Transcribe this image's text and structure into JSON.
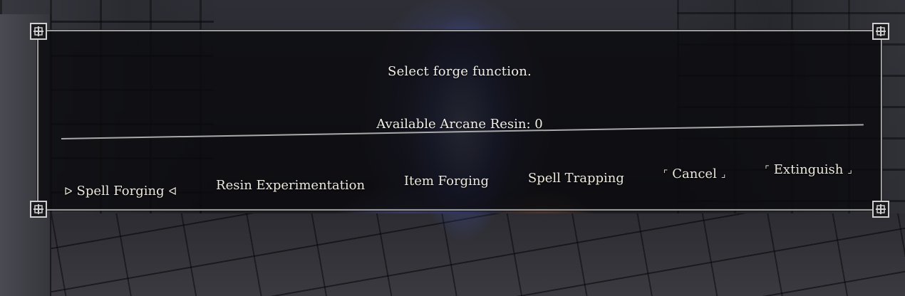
{
  "dialog": {
    "title": "Select forge function.",
    "resin_text": "Available Arcane Resin: 0"
  },
  "options": [
    {
      "label": "Spell Forging",
      "selected": true,
      "marker_left": "ᐅ",
      "marker_right": "ᐊ"
    },
    {
      "label": "Resin Experimentation",
      "selected": false
    },
    {
      "label": "Item Forging",
      "selected": false
    },
    {
      "label": "Spell Trapping",
      "selected": false
    },
    {
      "label": "Cancel",
      "selected": false,
      "bracket_left": "⌜",
      "bracket_right": "⌟"
    },
    {
      "label": "Extinguish",
      "selected": false,
      "bracket_left": "⌜",
      "bracket_right": "⌟"
    }
  ],
  "colors": {
    "text": "#f2efe6",
    "border": "#9a9a9a",
    "panel": "#0c0c10"
  },
  "icons": {
    "corner": "celtic-knot-corner-icon",
    "selection_left": "selection-arrow-right-icon",
    "selection_right": "selection-arrow-left-icon"
  }
}
